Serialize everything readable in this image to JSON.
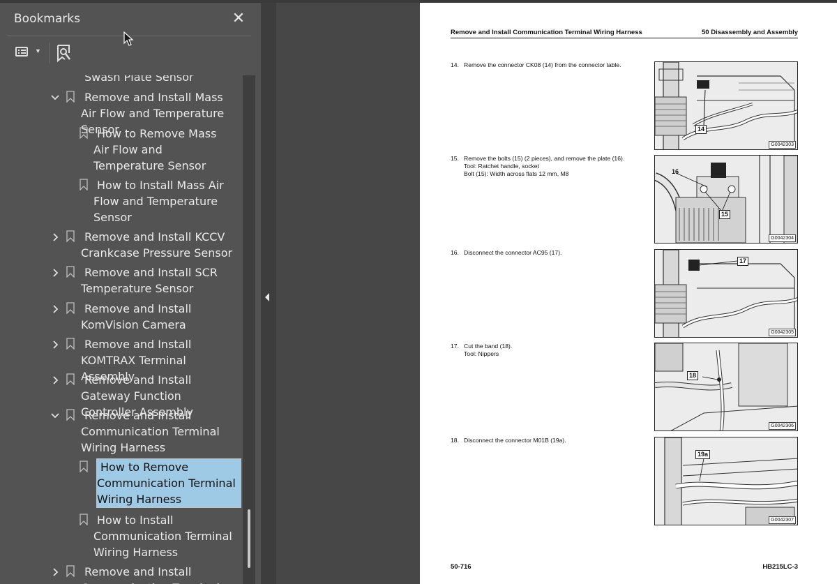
{
  "panel": {
    "title": "Bookmarks",
    "close_icon": "close-icon",
    "options_icon": "list-options-icon",
    "add_bookmark_icon": "bookmark-add-icon"
  },
  "tree": {
    "partial_top": "Swash Plate Sensor",
    "items": [
      {
        "label": "Remove and Install Mass Air Flow and Temperature Sensor",
        "level": 0,
        "state": "expanded"
      },
      {
        "label": "How to Remove Mass Air Flow and Temperature Sensor",
        "level": 1,
        "state": "leaf"
      },
      {
        "label": "How to Install Mass Air Flow and Temperature Sensor",
        "level": 1,
        "state": "leaf"
      },
      {
        "label": "Remove and Install KCCV Crankcase Pressure Sensor",
        "level": 0,
        "state": "collapsed"
      },
      {
        "label": "Remove and Install SCR Temperature Sensor",
        "level": 0,
        "state": "collapsed"
      },
      {
        "label": "Remove and Install KomVision Camera",
        "level": 0,
        "state": "collapsed"
      },
      {
        "label": "Remove and Install KOMTRAX Terminal Assembly",
        "level": 0,
        "state": "collapsed"
      },
      {
        "label": "Remove and Install Gateway Function Controller Assembly",
        "level": 0,
        "state": "collapsed"
      },
      {
        "label": "Remove and Install Communication Terminal Wiring Harness",
        "level": 0,
        "state": "expanded"
      },
      {
        "label": "How to Remove Communication Terminal Wiring Harness",
        "level": 1,
        "state": "leaf",
        "selected": true
      },
      {
        "label": "How to Install Communication Terminal Wiring Harness",
        "level": 1,
        "state": "leaf"
      },
      {
        "label": "Remove and Install Communication Terminal",
        "level": 0,
        "state": "collapsed"
      }
    ]
  },
  "document": {
    "header_left": "Remove and Install Communication Terminal Wiring Harness",
    "header_right": "50 Disassembly and Assembly",
    "steps": [
      {
        "num": "14.",
        "text": "Remove the connector CK08 (14) from the connector table.",
        "notes": [],
        "callouts": [
          "14"
        ],
        "figure_id": "G0042303"
      },
      {
        "num": "15.",
        "text": "Remove the bolts (15) (2 pieces), and remove the plate (16).",
        "notes": [
          "Tool: Ratchet handle, socket",
          "Bolt (15): Width across flats 12 mm, M8"
        ],
        "callouts": [
          "16",
          "15"
        ],
        "figure_id": "G0042304"
      },
      {
        "num": "16.",
        "text": "Disconnect the connector AC95 (17).",
        "notes": [],
        "callouts": [
          "17"
        ],
        "figure_id": "G0042305"
      },
      {
        "num": "17.",
        "text": "Cut the band (18).",
        "notes": [
          "Tool: Nippers"
        ],
        "callouts": [
          "18"
        ],
        "figure_id": "G0042306"
      },
      {
        "num": "18.",
        "text": "Disconnect the connector M01B (19a).",
        "notes": [],
        "callouts": [
          "19a"
        ],
        "figure_id": "G0042307"
      }
    ],
    "footer_left": "50-716",
    "footer_right": "HB215LC-3"
  },
  "colors": {
    "panel_bg": "#535353",
    "viewer_bg": "#474747",
    "selection": "#9ecae6"
  }
}
